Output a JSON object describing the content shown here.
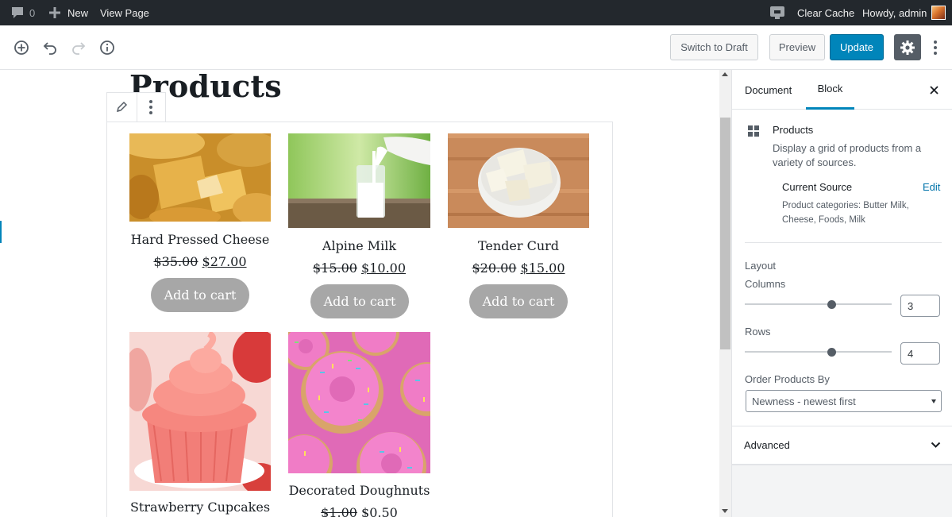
{
  "adminbar": {
    "comments_count": "0",
    "new_label": "New",
    "view_page_label": "View Page",
    "clear_cache_label": "Clear Cache",
    "howdy_label": "Howdy, admin"
  },
  "toolbar": {
    "switch_draft_label": "Switch to Draft",
    "preview_label": "Preview",
    "update_label": "Update"
  },
  "page": {
    "title": "Products"
  },
  "products": [
    {
      "name": "Hard Pressed Cheese",
      "old_price": "$35.00",
      "new_price": "$27.00",
      "cart_label": "Add to cart"
    },
    {
      "name": "Alpine Milk",
      "old_price": "$15.00",
      "new_price": "$10.00",
      "cart_label": "Add to cart"
    },
    {
      "name": "Tender Curd",
      "old_price": "$20.00",
      "new_price": "$15.00",
      "cart_label": "Add to cart"
    },
    {
      "name": "Strawberry Cupcakes"
    },
    {
      "name": "Decorated Doughnuts",
      "old_price": "$1.00",
      "new_price": "$0.50"
    }
  ],
  "sidebar": {
    "tab_document": "Document",
    "tab_block": "Block",
    "block_name": "Products",
    "block_description": "Display a grid of products from a variety of sources.",
    "current_source_label": "Current Source",
    "edit_label": "Edit",
    "source_text": "Product categories: Butter Milk, Cheese, Foods, Milk",
    "layout_label": "Layout",
    "columns_label": "Columns",
    "columns_value": "3",
    "columns_level": 0.59,
    "rows_label": "Rows",
    "rows_value": "4",
    "rows_level": 0.59,
    "order_label": "Order Products By",
    "order_value": "Newness - newest first",
    "advanced_label": "Advanced"
  },
  "colors": {
    "adminbar": "#23282d",
    "primary": "#0085ba",
    "cart_button": "#a7a7a7"
  }
}
